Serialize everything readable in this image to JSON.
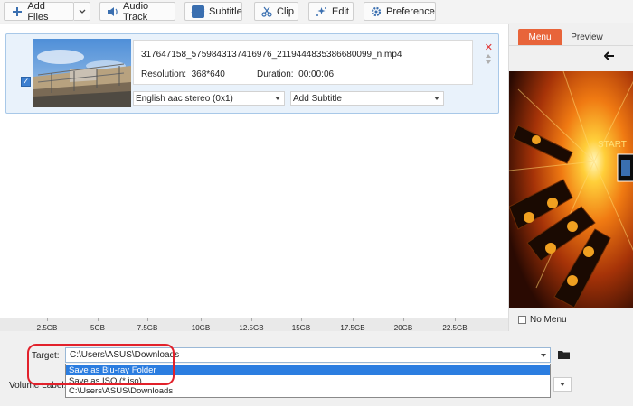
{
  "toolbar": {
    "add_files": "Add Files",
    "audio_track": "Audio Track",
    "subtitle": "Subtitle",
    "subtitle_badge": "ABC",
    "clip": "Clip",
    "edit": "Edit",
    "preference": "Preference"
  },
  "file": {
    "name": "317647158_5759843137416976_2119444835386680099_n.mp4",
    "resolution_label": "Resolution:",
    "resolution": "368*640",
    "duration_label": "Duration:",
    "duration": "00:00:06",
    "audio_track": "English aac stereo (0x1)",
    "subtitle": "Add Subtitle",
    "checked": true
  },
  "right_panel": {
    "tab_menu": "Menu",
    "tab_preview": "Preview",
    "preview_text": "START",
    "no_menu": "No Menu"
  },
  "scale": {
    "ticks": [
      "2.5GB",
      "5GB",
      "7.5GB",
      "10GB",
      "12.5GB",
      "15GB",
      "17.5GB",
      "20GB",
      "22.5GB"
    ]
  },
  "bottom": {
    "target_label": "Target:",
    "target_value": "C:\\Users\\ASUS\\Downloads",
    "options": [
      "Save as Blu-ray Folder",
      "Save as ISO (*.iso)",
      "C:\\Users\\ASUS\\Downloads"
    ],
    "volume_label": "Volume Label:"
  },
  "colors": {
    "accent": "#e8643a",
    "selection": "#2b7de0",
    "highlight_ring": "#e2212b"
  }
}
